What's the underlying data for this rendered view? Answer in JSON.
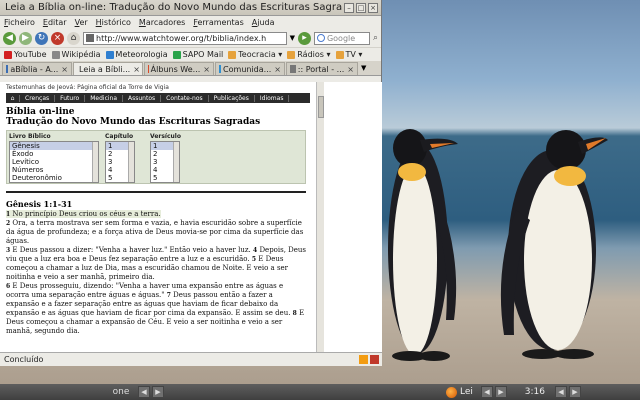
{
  "window": {
    "title": "Leia a Bíblia on-line: Tradução do Novo Mundo das Escrituras Sagradas - ..."
  },
  "menubar": [
    "Ficheiro",
    "Editar",
    "Ver",
    "Histórico",
    "Marcadores",
    "Ferramentas",
    "Ajuda"
  ],
  "navbar": {
    "url": "http://www.watchtower.org/t/biblia/index.h",
    "search_placeholder": "Google"
  },
  "bookmarks": [
    {
      "label": "YouTube",
      "color": "#d32020"
    },
    {
      "label": "Wikipédia",
      "color": "#888888"
    },
    {
      "label": "Meteorologia",
      "color": "#2f7fd0"
    },
    {
      "label": "SAPO Mail",
      "color": "#2aa34a"
    },
    {
      "label": "Teocracia ▾",
      "color": "#e6a23c"
    },
    {
      "label": "Rádios ▾",
      "color": "#e6a23c"
    },
    {
      "label": "TV ▾",
      "color": "#e6a23c"
    }
  ],
  "tabs": [
    {
      "label": "aBíblia - A...",
      "color": "#3b6db3"
    },
    {
      "label": "Leia a Bíbli...",
      "color": "#6b6b6b"
    },
    {
      "label": "Álbuns We...",
      "color": "#d94a2a"
    },
    {
      "label": "Comunida...",
      "color": "#2f8fd0"
    },
    {
      "label": ":: Portal - ...",
      "color": "#777777"
    }
  ],
  "page": {
    "site_tag": "Testemunhas de Jeová: Página oficial da Torre de Vigia",
    "site_nav": [
      "Crenças",
      "Futuro",
      "Medicina",
      "Assuntos",
      "Contate-nos",
      "Publicações",
      "Idiomas"
    ],
    "title_line1": "Bíblia on-line",
    "title_line2": "Tradução do Novo Mundo das Escrituras Sagradas",
    "selector": {
      "book_label": "Livro Bíblico",
      "books": [
        "Gênesis",
        "Êxodo",
        "Levítico",
        "Números",
        "Deuteronômio"
      ],
      "chapter_label": "Capítulo",
      "chapters": [
        "1",
        "2",
        "3",
        "4",
        "5"
      ],
      "verse_label": "Versículo",
      "verses": [
        "1",
        "2",
        "3",
        "4",
        "5"
      ]
    },
    "chapter_heading": "Gênesis 1:1-31",
    "verses": [
      {
        "n": "1",
        "text": "No princípio Deus criou os céus e a terra."
      },
      {
        "n": "2",
        "text": "Ora, a terra mostrava ser sem forma e vazia, e havia escuridão sobre a superfície da água de profundeza; e a força ativa de Deus movia-se por cima da superfície das águas."
      },
      {
        "n": "3",
        "text": "E Deus passou a dizer: \"Venha a haver luz.\" Então veio a haver luz."
      },
      {
        "n": "4",
        "text": "Depois, Deus viu que a luz era boa e Deus fez separação entre a luz e a escuridão."
      },
      {
        "n": "5",
        "text": "E Deus começou a chamar a luz de Dia, mas a escuridão chamou de Noite. E veio a ser noitinha e veio a ser manhã, primeiro dia."
      },
      {
        "n": "6",
        "text": "E Deus prosseguiu, dizendo: \"Venha a haver uma expansão entre as águas e ocorra uma separação entre águas e águas.\""
      },
      {
        "n": "7",
        "text": "Deus passou então a fazer a expansão e a fazer separação entre as águas que haviam de ficar debaixo da expansão e as águas que haviam de ficar por cima da expansão. E assim se deu."
      },
      {
        "n": "8",
        "text": "E Deus começou a chamar a expansão de Céu. E veio a ser noitinha e veio a ser manhã, segundo dia."
      }
    ]
  },
  "status": {
    "text": "Concluído"
  },
  "taskbar": {
    "desktop_label": "one",
    "app_label": "Lei",
    "clock": "3:16"
  }
}
